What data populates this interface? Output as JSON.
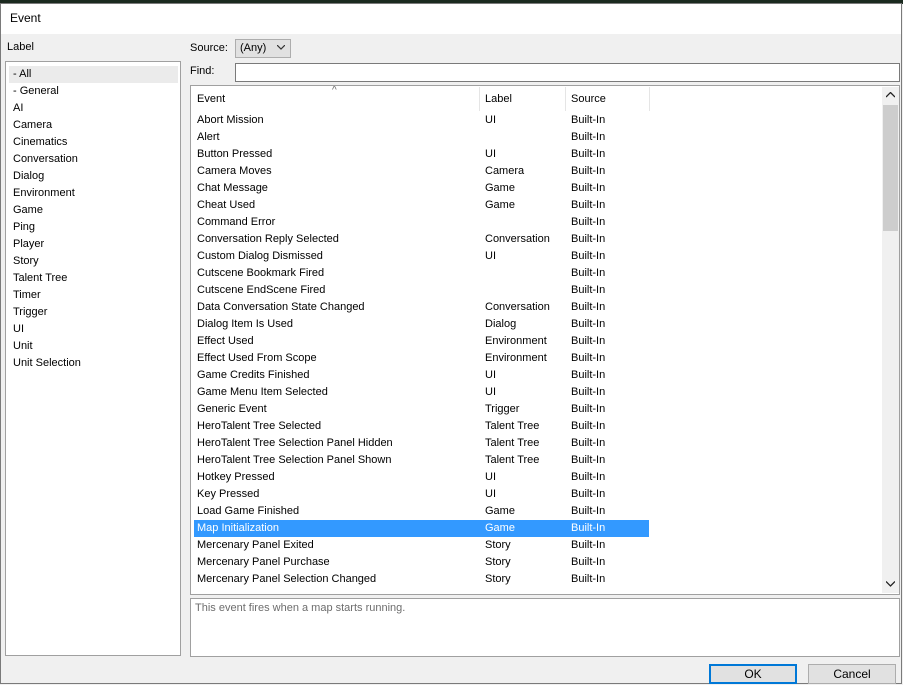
{
  "window": {
    "title": "Event"
  },
  "left_pane": {
    "header": "Label",
    "items": [
      {
        "label": "- All",
        "selected": true
      },
      {
        "label": "- General"
      },
      {
        "label": "AI"
      },
      {
        "label": "Camera"
      },
      {
        "label": "Cinematics"
      },
      {
        "label": "Conversation"
      },
      {
        "label": "Dialog"
      },
      {
        "label": "Environment"
      },
      {
        "label": "Game"
      },
      {
        "label": "Ping"
      },
      {
        "label": "Player"
      },
      {
        "label": "Story"
      },
      {
        "label": "Talent Tree"
      },
      {
        "label": "Timer"
      },
      {
        "label": "Trigger"
      },
      {
        "label": "UI"
      },
      {
        "label": "Unit"
      },
      {
        "label": "Unit Selection"
      }
    ]
  },
  "filters": {
    "source_label": "Source:",
    "source_value": "(Any)",
    "find_label": "Find:",
    "find_value": ""
  },
  "table": {
    "columns": [
      "Event",
      "Label",
      "Source"
    ],
    "sort_icon": "^",
    "rows": [
      {
        "event": "Abort Mission",
        "label": "UI",
        "source": "Built-In"
      },
      {
        "event": "Alert",
        "label": "",
        "source": "Built-In"
      },
      {
        "event": "Button Pressed",
        "label": "UI",
        "source": "Built-In"
      },
      {
        "event": "Camera Moves",
        "label": "Camera",
        "source": "Built-In"
      },
      {
        "event": "Chat Message",
        "label": "Game",
        "source": "Built-In"
      },
      {
        "event": "Cheat Used",
        "label": "Game",
        "source": "Built-In"
      },
      {
        "event": "Command Error",
        "label": "",
        "source": "Built-In"
      },
      {
        "event": "Conversation Reply Selected",
        "label": "Conversation",
        "source": "Built-In"
      },
      {
        "event": "Custom Dialog Dismissed",
        "label": "UI",
        "source": "Built-In"
      },
      {
        "event": "Cutscene Bookmark Fired",
        "label": "",
        "source": "Built-In"
      },
      {
        "event": "Cutscene EndScene Fired",
        "label": "",
        "source": "Built-In"
      },
      {
        "event": "Data Conversation State Changed",
        "label": "Conversation",
        "source": "Built-In"
      },
      {
        "event": "Dialog Item Is Used",
        "label": "Dialog",
        "source": "Built-In"
      },
      {
        "event": "Effect Used",
        "label": "Environment",
        "source": "Built-In"
      },
      {
        "event": "Effect Used From Scope",
        "label": "Environment",
        "source": "Built-In"
      },
      {
        "event": "Game Credits Finished",
        "label": "UI",
        "source": "Built-In"
      },
      {
        "event": "Game Menu Item Selected",
        "label": "UI",
        "source": "Built-In"
      },
      {
        "event": "Generic Event",
        "label": "Trigger",
        "source": "Built-In"
      },
      {
        "event": "HeroTalent Tree Selected",
        "label": "Talent Tree",
        "source": "Built-In"
      },
      {
        "event": "HeroTalent Tree Selection Panel Hidden",
        "label": "Talent Tree",
        "source": "Built-In"
      },
      {
        "event": "HeroTalent Tree Selection Panel Shown",
        "label": "Talent Tree",
        "source": "Built-In"
      },
      {
        "event": "Hotkey Pressed",
        "label": "UI",
        "source": "Built-In"
      },
      {
        "event": "Key Pressed",
        "label": "UI",
        "source": "Built-In"
      },
      {
        "event": "Load Game Finished",
        "label": "Game",
        "source": "Built-In"
      },
      {
        "event": "Map Initialization",
        "label": "Game",
        "source": "Built-In",
        "selected": true
      },
      {
        "event": "Mercenary Panel Exited",
        "label": "Story",
        "source": "Built-In"
      },
      {
        "event": "Mercenary Panel Purchase",
        "label": "Story",
        "source": "Built-In"
      },
      {
        "event": "Mercenary Panel Selection Changed",
        "label": "Story",
        "source": "Built-In"
      }
    ]
  },
  "scrollbar": {
    "up_icon": "chevron-up-icon",
    "down_icon": "chevron-down-icon"
  },
  "description": "This event fires when a map starts running.",
  "buttons": {
    "ok": "OK",
    "cancel": "Cancel"
  },
  "colors": {
    "selection": "#3399ff",
    "ok_border": "#0078d7"
  }
}
